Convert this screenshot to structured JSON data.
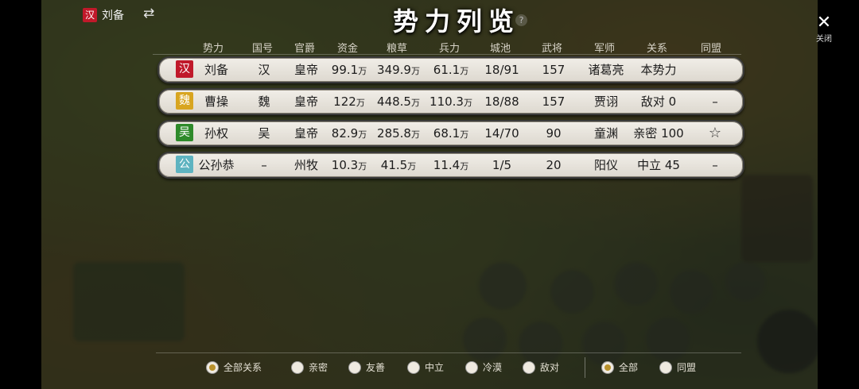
{
  "player": {
    "seal": "汉",
    "name": "刘备",
    "seal_color": "#c0192a"
  },
  "title": "势力列览",
  "help_icon": "?",
  "close": {
    "icon": "✕",
    "label": "关闭"
  },
  "columns": [
    "势力",
    "国号",
    "官爵",
    "资金",
    "粮草",
    "兵力",
    "城池",
    "武将",
    "军师",
    "关系",
    "同盟"
  ],
  "rows": [
    {
      "seal": "汉",
      "seal_color": "#c0192a",
      "ruler": "刘备",
      "country": "汉",
      "title": "皇帝",
      "funds": "99.1",
      "grain": "349.9",
      "troops": "61.1",
      "unit": "万",
      "cities": "18/91",
      "generals": "157",
      "advisor": "诸葛亮",
      "relation": "本势力",
      "alliance": ""
    },
    {
      "seal": "魏",
      "seal_color": "#d8a520",
      "ruler": "曹操",
      "country": "魏",
      "title": "皇帝",
      "funds": "122",
      "grain": "448.5",
      "troops": "110.3",
      "unit": "万",
      "cities": "18/88",
      "generals": "157",
      "advisor": "贾诩",
      "relation": "敌对 0",
      "alliance": "–"
    },
    {
      "seal": "吴",
      "seal_color": "#2e8a2a",
      "ruler": "孙权",
      "country": "吴",
      "title": "皇帝",
      "funds": "82.9",
      "grain": "285.8",
      "troops": "68.1",
      "unit": "万",
      "cities": "14/70",
      "generals": "90",
      "advisor": "童渊",
      "relation": "亲密 100",
      "alliance": "☆"
    },
    {
      "seal": "公",
      "seal_color": "#5eb3c0",
      "ruler": "公孙恭",
      "country": "–",
      "title": "州牧",
      "funds": "10.3",
      "grain": "41.5",
      "troops": "11.4",
      "unit": "万",
      "cities": "1/5",
      "generals": "20",
      "advisor": "阳仪",
      "relation": "中立 45",
      "alliance": "–"
    }
  ],
  "relation_filters": [
    {
      "label": "全部关系",
      "selected": true
    },
    {
      "label": "亲密",
      "selected": false
    },
    {
      "label": "友善",
      "selected": false
    },
    {
      "label": "中立",
      "selected": false
    },
    {
      "label": "冷漠",
      "selected": false
    },
    {
      "label": "敌对",
      "selected": false
    }
  ],
  "alliance_filters": [
    {
      "label": "全部",
      "selected": true
    },
    {
      "label": "同盟",
      "selected": false
    }
  ]
}
